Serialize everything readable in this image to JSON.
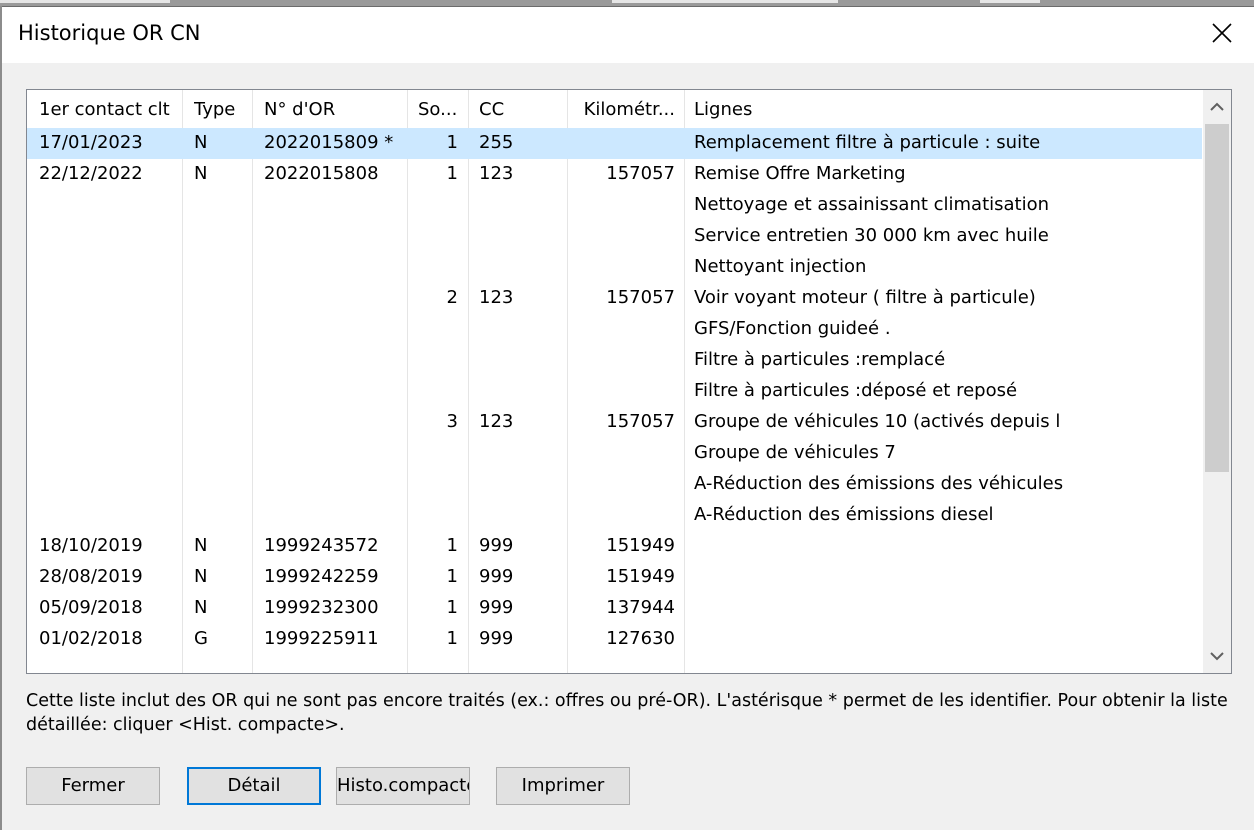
{
  "dialog": {
    "title": "Historique OR CN"
  },
  "table": {
    "columns": [
      "1er contact clt",
      "Type",
      "N° d'OR",
      "So...",
      "CC",
      "Kilométr...",
      "Lignes"
    ],
    "rows": [
      {
        "date": "17/01/2023",
        "type": "N",
        "or": "2022015809 *",
        "so": "1",
        "cc": "255",
        "km": "",
        "ligne": "Remplacement filtre à particule : suite",
        "selected": true
      },
      {
        "date": "22/12/2022",
        "type": "N",
        "or": "2022015808",
        "so": "1",
        "cc": "123",
        "km": "157057",
        "ligne": "Remise Offre Marketing"
      },
      {
        "date": "",
        "type": "",
        "or": "",
        "so": "",
        "cc": "",
        "km": "",
        "ligne": "Nettoyage et assainissant climatisation"
      },
      {
        "date": "",
        "type": "",
        "or": "",
        "so": "",
        "cc": "",
        "km": "",
        "ligne": "Service entretien 30 000 km avec huile"
      },
      {
        "date": "",
        "type": "",
        "or": "",
        "so": "",
        "cc": "",
        "km": "",
        "ligne": "Nettoyant injection"
      },
      {
        "date": "",
        "type": "",
        "or": "",
        "so": "2",
        "cc": "123",
        "km": "157057",
        "ligne": "Voir voyant moteur ( filtre à particule)"
      },
      {
        "date": "",
        "type": "",
        "or": "",
        "so": "",
        "cc": "",
        "km": "",
        "ligne": "GFS/Fonction guideé ."
      },
      {
        "date": "",
        "type": "",
        "or": "",
        "so": "",
        "cc": "",
        "km": "",
        "ligne": "Filtre à particules :remplacé"
      },
      {
        "date": "",
        "type": "",
        "or": "",
        "so": "",
        "cc": "",
        "km": "",
        "ligne": "Filtre à particules :déposé et reposé"
      },
      {
        "date": "",
        "type": "",
        "or": "",
        "so": "3",
        "cc": "123",
        "km": "157057",
        "ligne": "Groupe de véhicules 10 (activés depuis l"
      },
      {
        "date": "",
        "type": "",
        "or": "",
        "so": "",
        "cc": "",
        "km": "",
        "ligne": "Groupe de véhicules 7"
      },
      {
        "date": "",
        "type": "",
        "or": "",
        "so": "",
        "cc": "",
        "km": "",
        "ligne": "A-Réduction des émissions des véhicules"
      },
      {
        "date": "",
        "type": "",
        "or": "",
        "so": "",
        "cc": "",
        "km": "",
        "ligne": "A-Réduction des émissions diesel"
      },
      {
        "date": "18/10/2019",
        "type": "N",
        "or": "1999243572",
        "so": "1",
        "cc": "999",
        "km": "151949",
        "ligne": ""
      },
      {
        "date": "28/08/2019",
        "type": "N",
        "or": "1999242259",
        "so": "1",
        "cc": "999",
        "km": "151949",
        "ligne": ""
      },
      {
        "date": "05/09/2018",
        "type": "N",
        "or": "1999232300",
        "so": "1",
        "cc": "999",
        "km": "137944",
        "ligne": ""
      },
      {
        "date": "01/02/2018",
        "type": "G",
        "or": "1999225911",
        "so": "1",
        "cc": "999",
        "km": "127630",
        "ligne": ""
      }
    ]
  },
  "info_text": "Cette liste inclut des OR qui ne sont pas encore traités (ex.: offres ou pré-OR). L'astérisque * permet de les identifier. Pour obtenir la liste détaillée: cliquer <Hist. compacte>.",
  "buttons": {
    "fermer": "Fermer",
    "detail": "Détail",
    "histo": "Histo.compacte",
    "imprimer": "Imprimer"
  },
  "colors": {
    "selection": "#cce8ff",
    "focus_border": "#0078d7"
  }
}
